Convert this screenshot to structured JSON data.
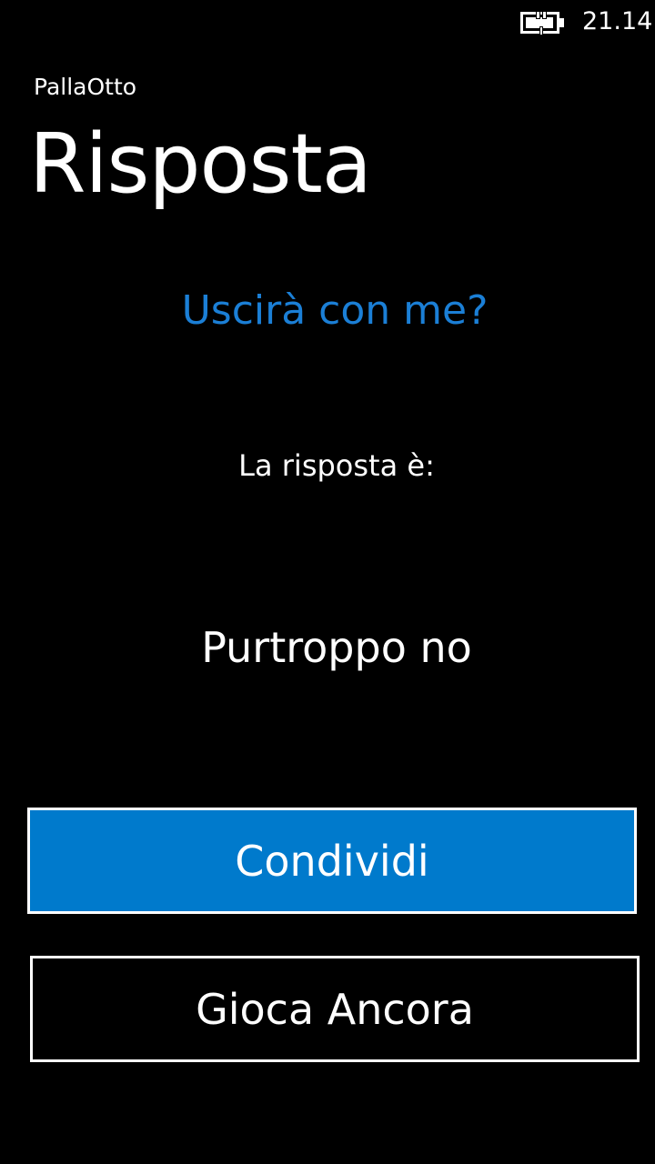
{
  "status_bar": {
    "time": "21.14",
    "battery_icon": "battery-charging-icon"
  },
  "app": {
    "name": "PallaOtto",
    "page_title": "Risposta"
  },
  "content": {
    "question": "Uscirà con me?",
    "answer_label": "La risposta è:",
    "answer": "Purtroppo no"
  },
  "buttons": {
    "share_label": "Condividi",
    "play_again_label": "Gioca Ancora"
  },
  "colors": {
    "background": "#000000",
    "accent": "#007acc",
    "question_text": "#1b7fd6",
    "text": "#ffffff"
  }
}
